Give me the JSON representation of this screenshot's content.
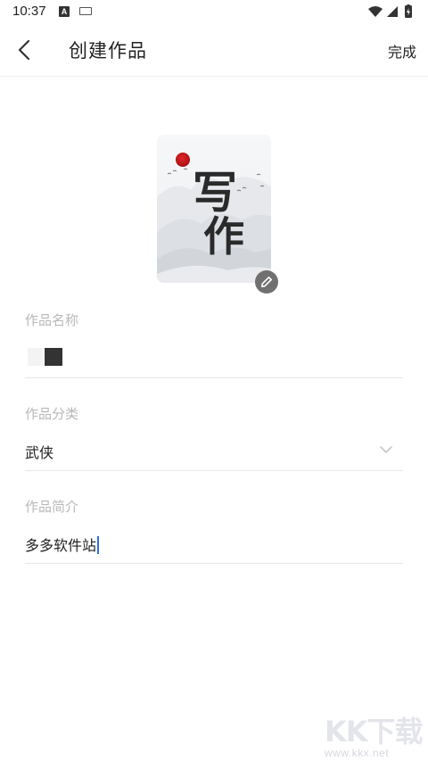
{
  "status_bar": {
    "time": "10:37",
    "notification_letter": "A"
  },
  "header": {
    "title": "创建作品",
    "done_label": "完成"
  },
  "cover": {
    "calligraphy_line1": "写",
    "calligraphy_line2": "作"
  },
  "form": {
    "name_label": "作品名称",
    "category_label": "作品分类",
    "category_value": "武侠",
    "intro_label": "作品简介",
    "intro_value": "多多软件站"
  },
  "watermark": {
    "main": "KK下载",
    "sub": "www.kkx.net"
  },
  "colors": {
    "label_gray": "#b8b8b8",
    "cursor_blue": "#2b6fe0",
    "seal_red": "#c0151a"
  }
}
